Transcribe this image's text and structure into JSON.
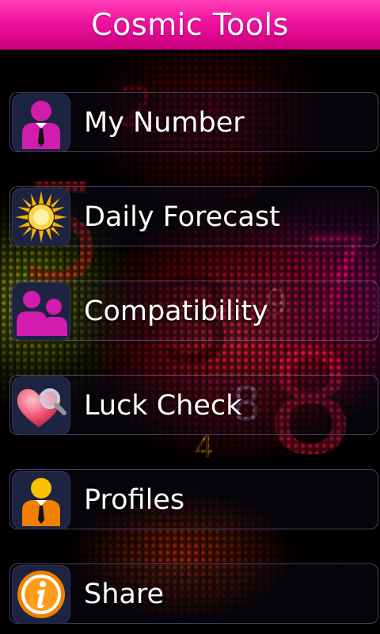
{
  "app": {
    "title": "Cosmic Tools",
    "accent": "#f012a0"
  },
  "menu": {
    "items": [
      {
        "label": "My Number",
        "icon": "person-magenta-icon"
      },
      {
        "label": "Daily Forecast",
        "icon": "sun-icon"
      },
      {
        "label": "Compatibility",
        "icon": "two-people-icon"
      },
      {
        "label": "Luck Check",
        "icon": "heart-magnifier-icon"
      },
      {
        "label": "Profiles",
        "icon": "person-orange-icon"
      },
      {
        "label": "Share",
        "icon": "info-icon"
      }
    ]
  },
  "background": {
    "digits": [
      "2",
      "9",
      "5",
      "9",
      "7",
      "3",
      "8",
      "8",
      "4"
    ]
  }
}
